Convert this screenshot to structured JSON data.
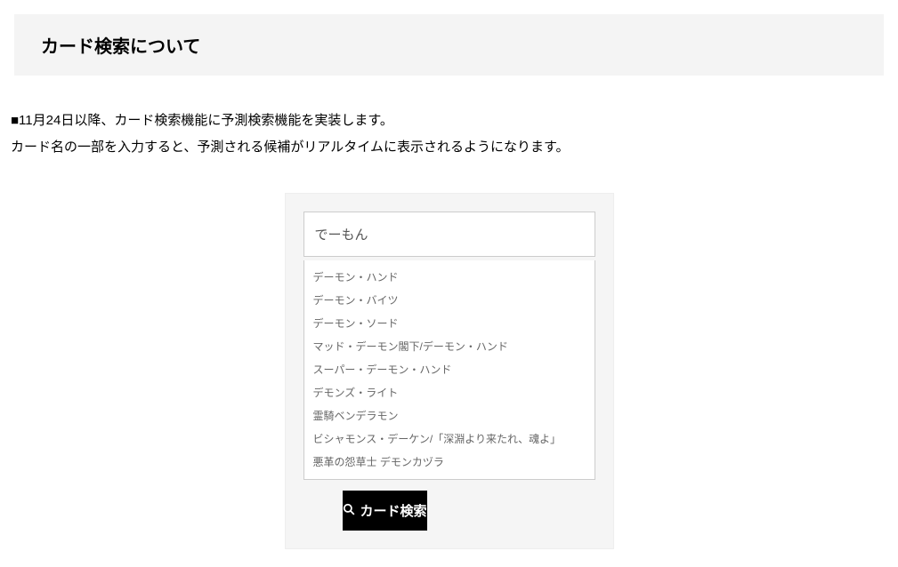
{
  "header": {
    "title": "カード検索について"
  },
  "notice": {
    "line1": "■11月24日以降、カード検索機能に予測検索機能を実装します。",
    "line2": "カード名の一部を入力すると、予測される候補がリアルタイムに表示されるようになります。"
  },
  "search": {
    "input_value": "でーもん",
    "button_label": "カード検索",
    "suggestions": [
      "デーモン・ハンド",
      "デーモン・バイツ",
      "デーモン・ソード",
      "マッド・デーモン閣下/デーモン・ハンド",
      "スーパー・デーモン・ハンド",
      "デモンズ・ライト",
      "霊騎ベンデラモン",
      "ビシャモンス・デーケン/「深淵より来たれ、魂よ」",
      "悪革の怨草士 デモンカヅラ"
    ]
  }
}
